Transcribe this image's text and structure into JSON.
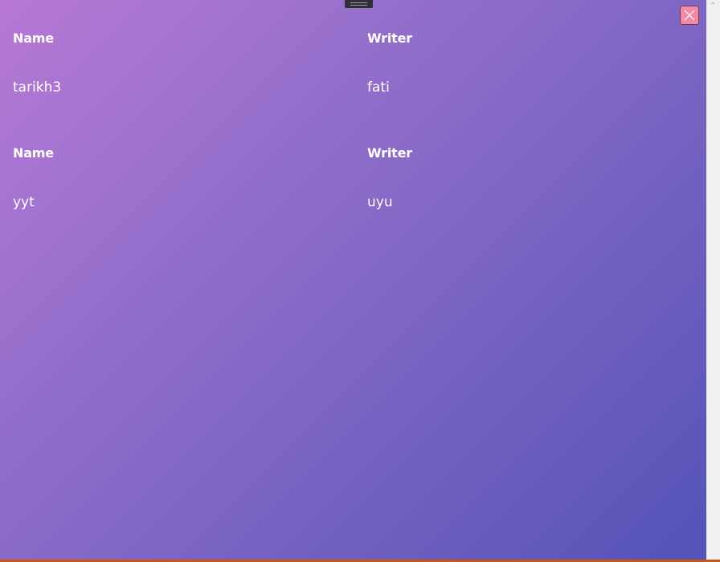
{
  "records": [
    {
      "name_label": "Name",
      "writer_label": "Writer",
      "name": "tarikh3",
      "writer": "fati"
    },
    {
      "name_label": "Name",
      "writer_label": "Writer",
      "name": "yyt",
      "writer": "uyu"
    }
  ],
  "icons": {
    "close": "close-icon",
    "drag": "drag-handle-icon",
    "scroll_up": "chevron-up-icon"
  },
  "colors": {
    "gradient_start": "#b878d6",
    "gradient_end": "#5453b8",
    "close_button": "#f08aa6",
    "text": "#ffffff",
    "bottom_accent": "#c8541e"
  }
}
